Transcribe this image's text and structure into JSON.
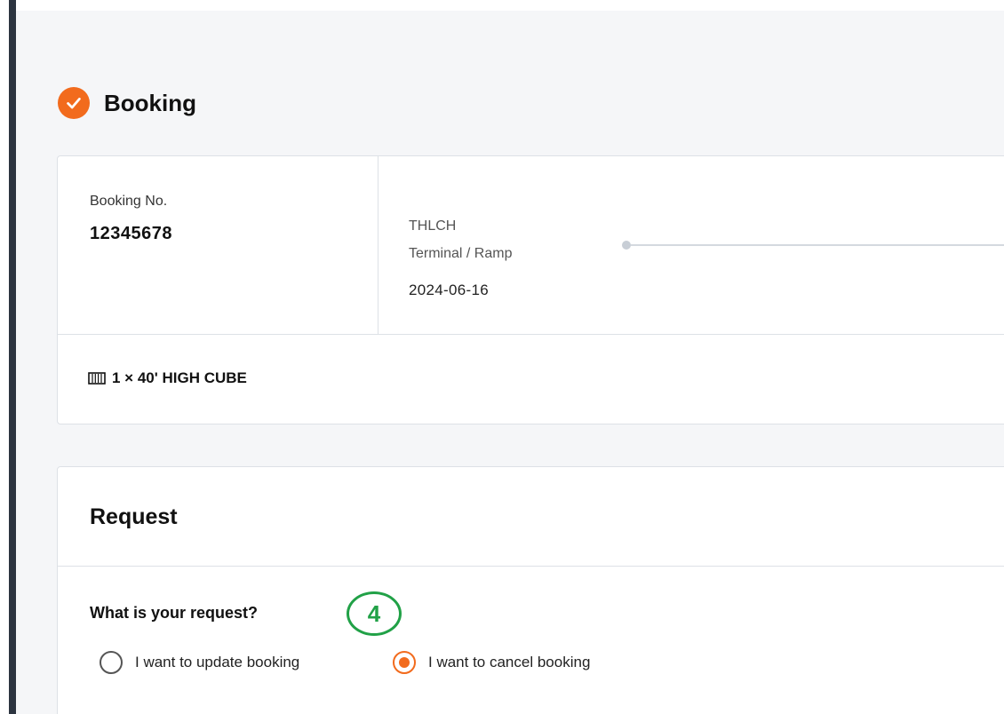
{
  "section": {
    "title": "Booking",
    "icon": "check-circle-icon",
    "accent_color": "#f26b1d"
  },
  "booking": {
    "number_label": "Booking No.",
    "number_value": "12345678",
    "origin": {
      "code": "THLCH",
      "type": "Terminal / Ramp",
      "date": "2024-06-16"
    },
    "container": {
      "icon": "container-icon",
      "description": "1 × 40' HIGH CUBE"
    }
  },
  "request": {
    "title": "Request",
    "question": "What is your request?",
    "step_marker": "4",
    "step_marker_color": "#21a147",
    "options": [
      {
        "label": "I want to update booking",
        "selected": false
      },
      {
        "label": "I want to cancel booking",
        "selected": true
      }
    ]
  }
}
